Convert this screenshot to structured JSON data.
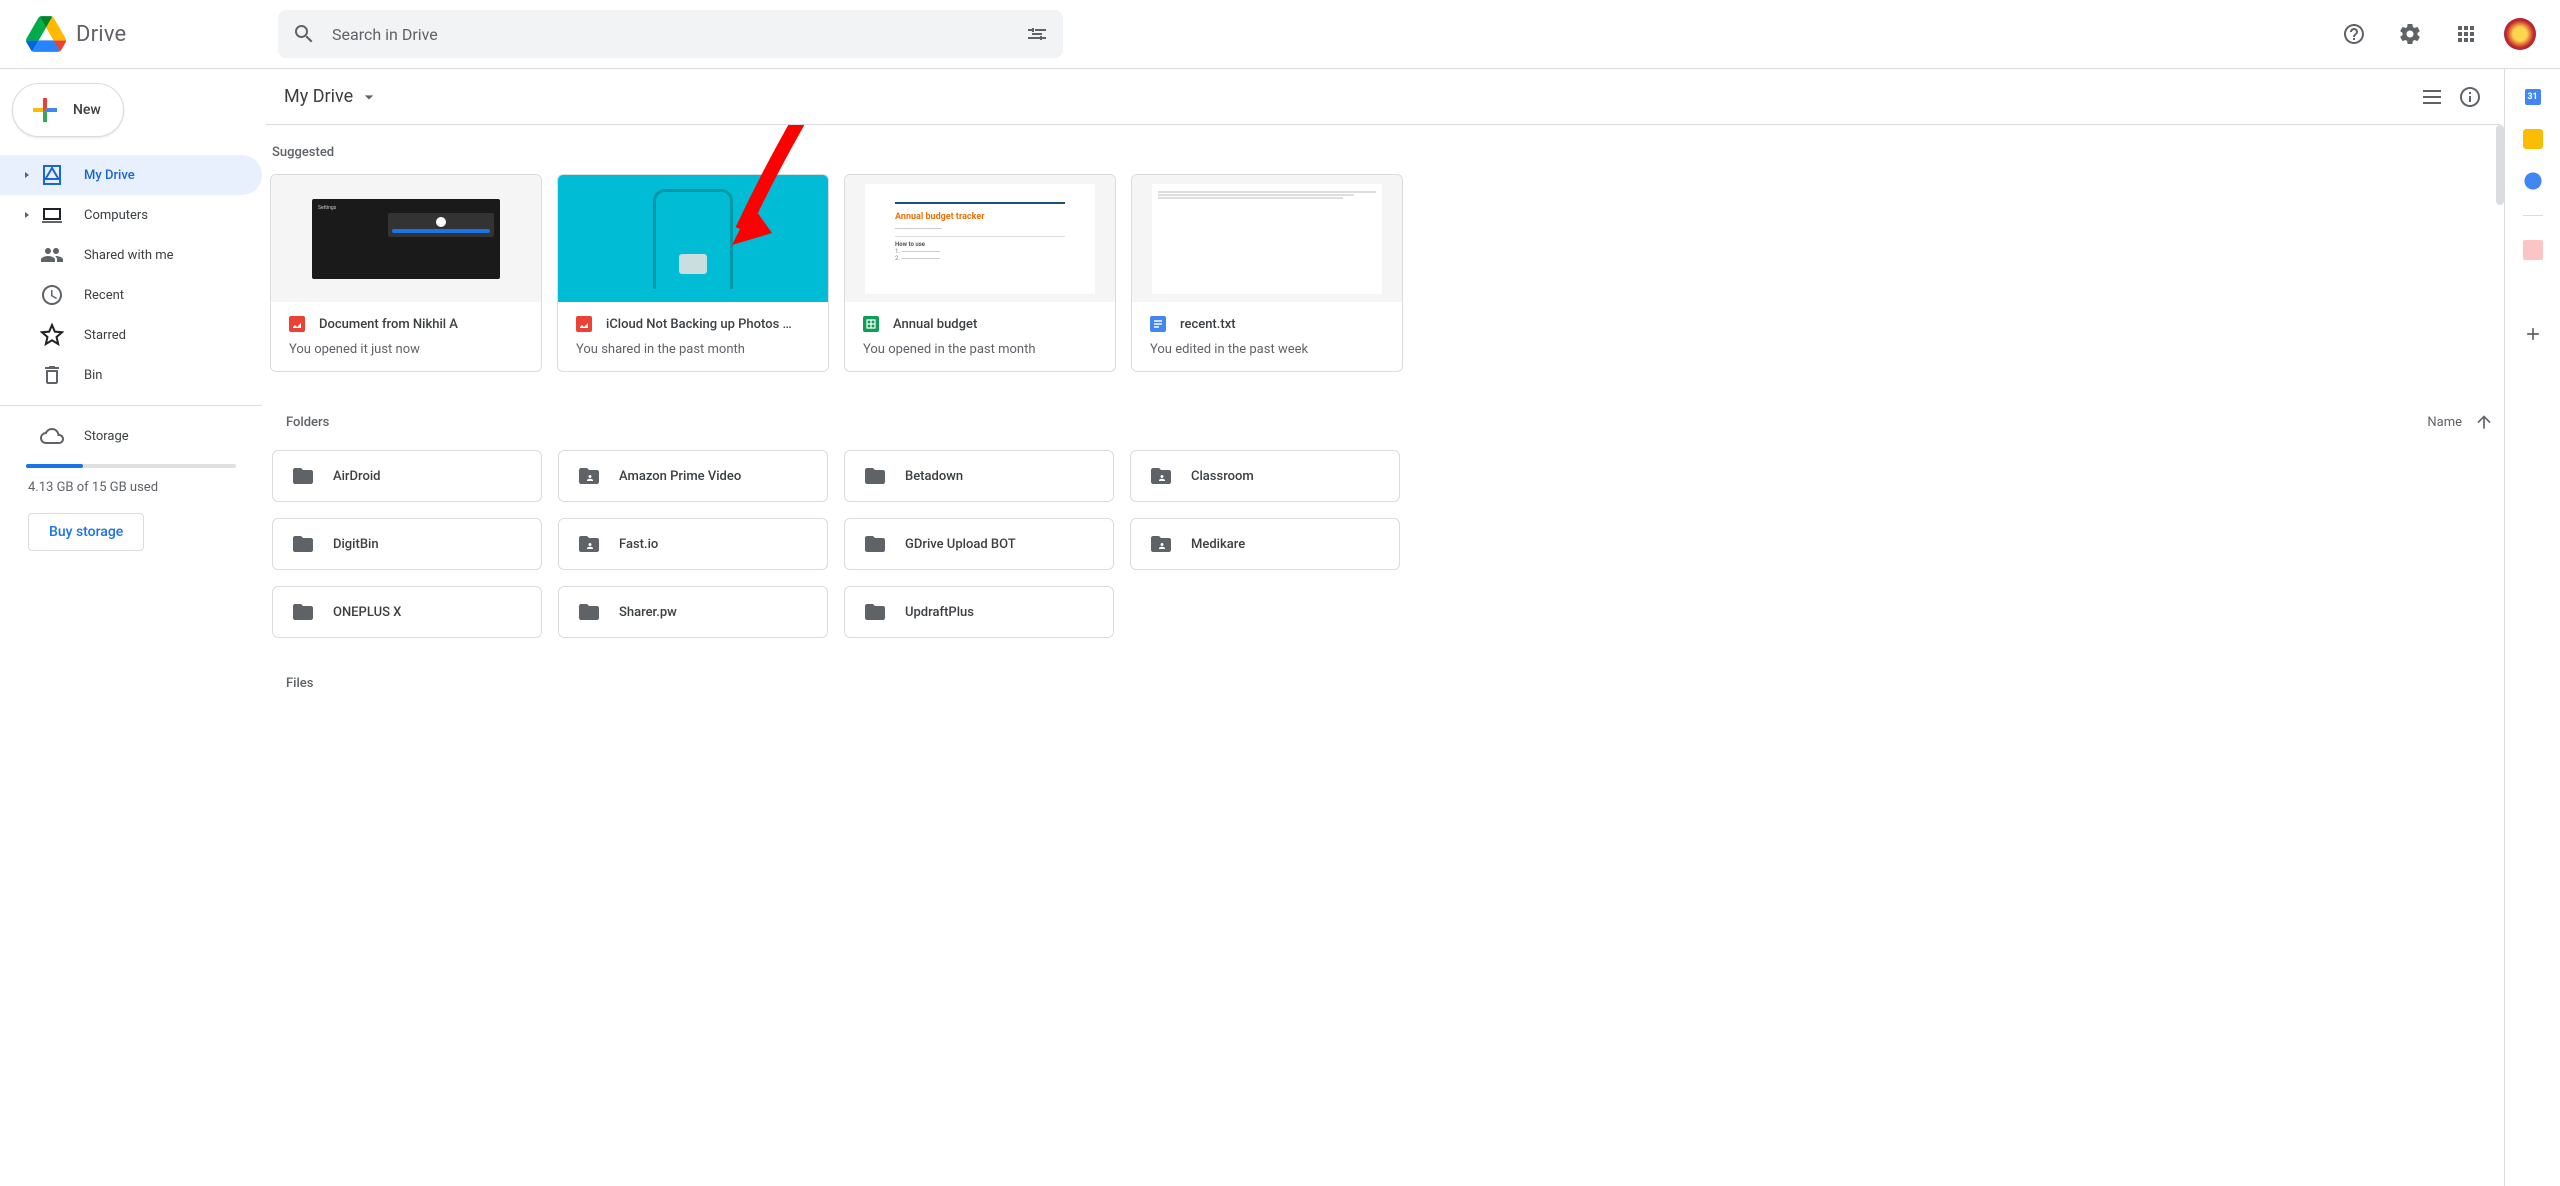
{
  "app": {
    "name": "Drive"
  },
  "search": {
    "placeholder": "Search in Drive"
  },
  "new_button": "New",
  "nav": [
    {
      "label": "My Drive",
      "icon": "drive",
      "caret": true,
      "active": true
    },
    {
      "label": "Computers",
      "icon": "computers",
      "caret": true
    },
    {
      "label": "Shared with me",
      "icon": "shared"
    },
    {
      "label": "Recent",
      "icon": "recent"
    },
    {
      "label": "Starred",
      "icon": "star"
    },
    {
      "label": "Bin",
      "icon": "bin"
    }
  ],
  "storage": {
    "label": "Storage",
    "used_text": "4.13 GB of 15 GB used",
    "buy": "Buy storage"
  },
  "breadcrumb": "My Drive",
  "sections": {
    "suggested": "Suggested",
    "folders": "Folders",
    "files": "Files"
  },
  "sort": {
    "label": "Name"
  },
  "suggested": [
    {
      "title": "Document from Nikhil A",
      "sub": "You opened it just now",
      "type": "image",
      "thumb": "dark"
    },
    {
      "title": "iCloud Not Backing up Photos …",
      "sub": "You shared in the past month",
      "type": "image",
      "thumb": "teal"
    },
    {
      "title": "Annual budget",
      "sub": "You opened in the past month",
      "type": "sheets",
      "thumb": "doc",
      "doc_title": "Annual budget tracker"
    },
    {
      "title": "recent.txt",
      "sub": "You edited in the past week",
      "type": "docs",
      "thumb": "txt"
    }
  ],
  "folders": [
    {
      "name": "AirDroid",
      "shared": false
    },
    {
      "name": "Amazon Prime Video",
      "shared": true
    },
    {
      "name": "Betadown",
      "shared": false
    },
    {
      "name": "Classroom",
      "shared": true
    },
    {
      "name": "DigitBin",
      "shared": false
    },
    {
      "name": "Fast.io",
      "shared": true
    },
    {
      "name": "GDrive Upload BOT",
      "shared": false
    },
    {
      "name": "Medikare",
      "shared": true
    },
    {
      "name": "ONEPLUS X",
      "shared": false
    },
    {
      "name": "Sharer.pw",
      "shared": false
    },
    {
      "name": "UpdraftPlus",
      "shared": false
    }
  ]
}
